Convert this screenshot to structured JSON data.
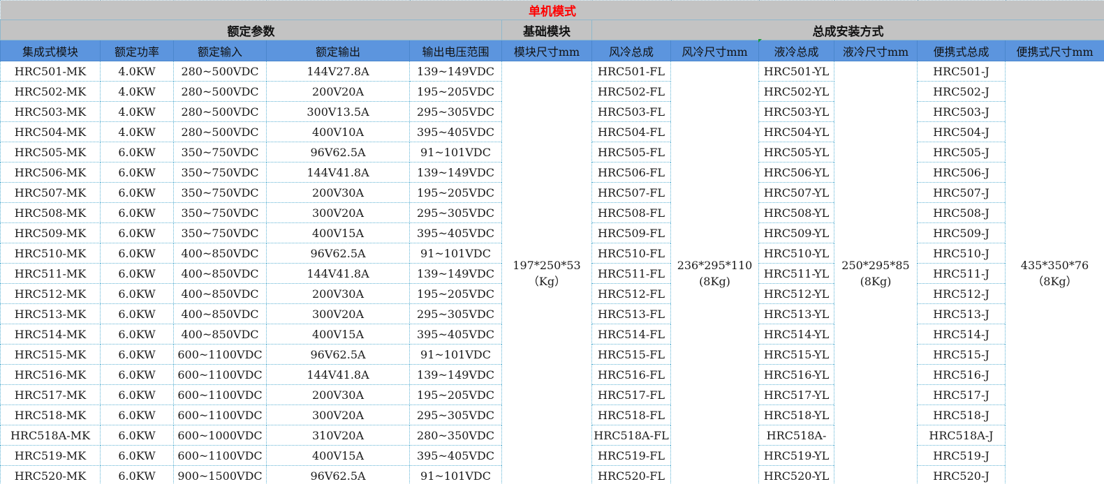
{
  "sheet": {
    "title": "单机模式",
    "groups": [
      "额定参数",
      "基础模块",
      "总成安装方式"
    ],
    "headers": [
      "集成式模块",
      "额定功率",
      "额定输入",
      "额定输出",
      "输出电压范围",
      "模块尺寸mm",
      "风冷总成",
      "风冷尺寸mm",
      "液冷总成",
      "液冷尺寸mm",
      "便携式总成",
      "便携式尺寸mm"
    ],
    "base_size": {
      "dims": "197*250*53",
      "weight": "（Kg）"
    },
    "air_size": {
      "dims": "236*295*110",
      "weight": "(8Kg)"
    },
    "liquid_size": {
      "dims": "250*295*85",
      "weight": "(8Kg)"
    },
    "portable_size": {
      "dims": "435*350*76",
      "weight": "（8Kg）"
    },
    "rows": [
      {
        "module": "HRC501-MK",
        "power": "4.0KW",
        "input": "280~500VDC",
        "output": "144V27.8A",
        "range": "139~149VDC",
        "air": "HRC501-FL",
        "liquid": "HRC501-YL",
        "portable": "HRC501-J"
      },
      {
        "module": "HRC502-MK",
        "power": "4.0KW",
        "input": "280~500VDC",
        "output": "200V20A",
        "range": "195~205VDC",
        "air": "HRC502-FL",
        "liquid": "HRC502-YL",
        "portable": "HRC502-J"
      },
      {
        "module": "HRC503-MK",
        "power": "4.0KW",
        "input": "280~500VDC",
        "output": "300V13.5A",
        "range": "295~305VDC",
        "air": "HRC503-FL",
        "liquid": "HRC503-YL",
        "portable": "HRC503-J"
      },
      {
        "module": "HRC504-MK",
        "power": "4.0KW",
        "input": "280~500VDC",
        "output": "400V10A",
        "range": "395~405VDC",
        "air": "HRC504-FL",
        "liquid": "HRC504-YL",
        "portable": "HRC504-J"
      },
      {
        "module": "HRC505-MK",
        "power": "6.0KW",
        "input": "350~750VDC",
        "output": "96V62.5A",
        "range": "91~101VDC",
        "air": "HRC505-FL",
        "liquid": "HRC505-YL",
        "portable": "HRC505-J"
      },
      {
        "module": "HRC506-MK",
        "power": "6.0KW",
        "input": "350~750VDC",
        "output": "144V41.8A",
        "range": "139~149VDC",
        "air": "HRC506-FL",
        "liquid": "HRC506-YL",
        "portable": "HRC506-J"
      },
      {
        "module": "HRC507-MK",
        "power": "6.0KW",
        "input": "350~750VDC",
        "output": "200V30A",
        "range": "195~205VDC",
        "air": "HRC507-FL",
        "liquid": "HRC507-YL",
        "portable": "HRC507-J"
      },
      {
        "module": "HRC508-MK",
        "power": "6.0KW",
        "input": "350~750VDC",
        "output": "300V20A",
        "range": "295~305VDC",
        "air": "HRC508-FL",
        "liquid": "HRC508-YL",
        "portable": "HRC508-J"
      },
      {
        "module": "HRC509-MK",
        "power": "6.0KW",
        "input": "350~750VDC",
        "output": "400V15A",
        "range": "395~405VDC",
        "air": "HRC509-FL",
        "liquid": "HRC509-YL",
        "portable": "HRC509-J"
      },
      {
        "module": "HRC510-MK",
        "power": "6.0KW",
        "input": "400~850VDC",
        "output": "96V62.5A",
        "range": "91~101VDC",
        "air": "HRC510-FL",
        "liquid": "HRC510-YL",
        "portable": "HRC510-J"
      },
      {
        "module": "HRC511-MK",
        "power": "6.0KW",
        "input": "400~850VDC",
        "output": "144V41.8A",
        "range": "139~149VDC",
        "air": "HRC511-FL",
        "liquid": "HRC511-YL",
        "portable": "HRC511-J"
      },
      {
        "module": "HRC512-MK",
        "power": "6.0KW",
        "input": "400~850VDC",
        "output": "200V30A",
        "range": "195~205VDC",
        "air": "HRC512-FL",
        "liquid": "HRC512-YL",
        "portable": "HRC512-J"
      },
      {
        "module": "HRC513-MK",
        "power": "6.0KW",
        "input": "400~850VDC",
        "output": "300V20A",
        "range": "295~305VDC",
        "air": "HRC513-FL",
        "liquid": "HRC513-YL",
        "portable": "HRC513-J"
      },
      {
        "module": "HRC514-MK",
        "power": "6.0KW",
        "input": "400~850VDC",
        "output": "400V15A",
        "range": "395~405VDC",
        "air": "HRC514-FL",
        "liquid": "HRC514-YL",
        "portable": "HRC514-J"
      },
      {
        "module": "HRC515-MK",
        "power": "6.0KW",
        "input": "600~1100VDC",
        "output": "96V62.5A",
        "range": "91~101VDC",
        "air": "HRC515-FL",
        "liquid": "HRC515-YL",
        "portable": "HRC515-J"
      },
      {
        "module": "HRC516-MK",
        "power": "6.0KW",
        "input": "600~1100VDC",
        "output": "144V41.8A",
        "range": "139~149VDC",
        "air": "HRC516-FL",
        "liquid": "HRC516-YL",
        "portable": "HRC516-J"
      },
      {
        "module": "HRC517-MK",
        "power": "6.0KW",
        "input": "600~1100VDC",
        "output": "200V30A",
        "range": "195~205VDC",
        "air": "HRC517-FL",
        "liquid": "HRC517-YL",
        "portable": "HRC517-J"
      },
      {
        "module": "HRC518-MK",
        "power": "6.0KW",
        "input": "600~1100VDC",
        "output": "300V20A",
        "range": "295~305VDC",
        "air": "HRC518-FL",
        "liquid": "HRC518-YL",
        "portable": "HRC518-J"
      },
      {
        "module": "HRC518A-MK",
        "power": "6.0KW",
        "input": "600~1000VDC",
        "output": "310V20A",
        "range": "280~350VDC",
        "air": "HRC518A-FL",
        "liquid": "HRC518A-",
        "portable": "HRC518A-J"
      },
      {
        "module": "HRC519-MK",
        "power": "6.0KW",
        "input": "600~1100VDC",
        "output": "400V15A",
        "range": "395~405VDC",
        "air": "HRC519-FL",
        "liquid": "HRC519-YL",
        "portable": "HRC519-J"
      },
      {
        "module": "HRC520-MK",
        "power": "6.0KW",
        "input": "900~1500VDC",
        "output": "96V62.5A",
        "range": "91~101VDC",
        "air": "HRC520-FL",
        "liquid": "HRC520-YL",
        "portable": "HRC520-J"
      }
    ]
  }
}
